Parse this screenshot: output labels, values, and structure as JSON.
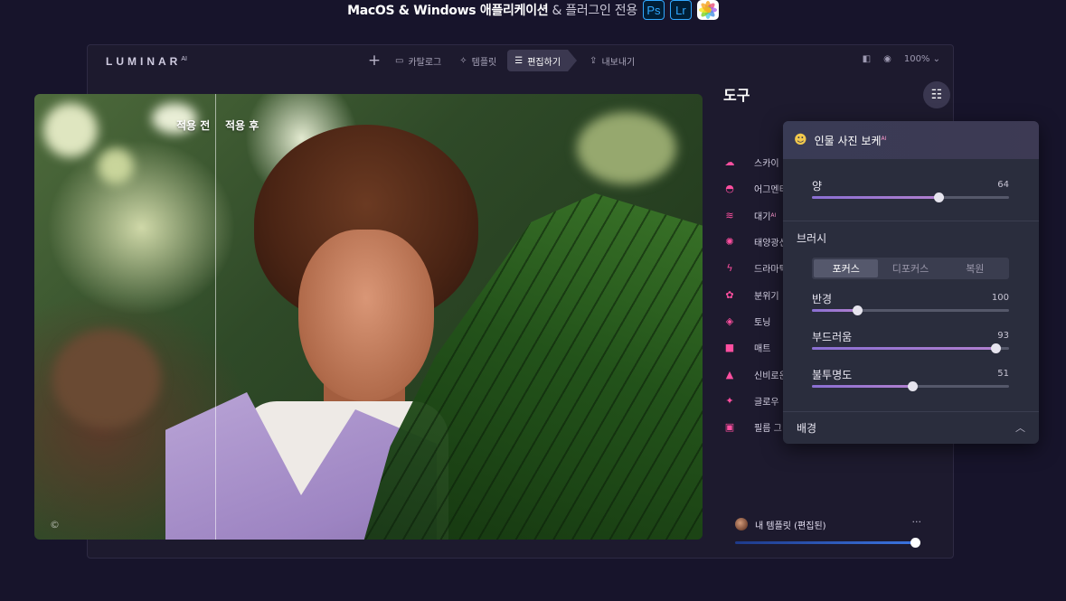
{
  "banner": {
    "text_main": "MacOS & Windows 애플리케이션",
    "text_sub": " & 플러그인 전용",
    "badges": [
      "Ps",
      "Lr"
    ]
  },
  "window": {
    "logo": "LUMINAR",
    "logo_sup": "AI",
    "nav": {
      "plus": "+",
      "catalog": "카탈로그",
      "templates": "템플릿",
      "edit": "편집하기",
      "export": "내보내기"
    },
    "zoom": "100%"
  },
  "photo": {
    "before_label": "적용 전",
    "after_label": "적용 후",
    "copyright": "©"
  },
  "tools": {
    "title": "도구",
    "items": [
      {
        "icon": "cloud-icon",
        "label": "스카이"
      },
      {
        "icon": "augmented-sky-icon",
        "label": "어그멘티"
      },
      {
        "icon": "atmosphere-icon",
        "label": "대기"
      },
      {
        "icon": "sunrays-icon",
        "label": "태양광선"
      },
      {
        "icon": "dramatic-icon",
        "label": "드라마틱"
      },
      {
        "icon": "mood-icon",
        "label": "분위기"
      },
      {
        "icon": "toning-icon",
        "label": "토닝"
      },
      {
        "icon": "matte-icon",
        "label": "매트"
      },
      {
        "icon": "mystical-icon",
        "label": "신비로운"
      },
      {
        "icon": "glow-icon",
        "label": "글로우"
      },
      {
        "icon": "film-grain-icon",
        "label": "필름 그"
      }
    ],
    "atmosphere_sup": "AI",
    "template": {
      "label": "내 템플릿 (편집된)",
      "more": "···"
    }
  },
  "popup": {
    "title": "인물 사진 보케",
    "title_sup": "AI",
    "amount": {
      "label": "양",
      "value": 64,
      "value_text": "64"
    },
    "brush": {
      "title": "브러시",
      "modes": [
        "포커스",
        "디포커스",
        "복원"
      ],
      "selected": "포커스"
    },
    "radius": {
      "label": "반경",
      "value": 100,
      "value_text": "100"
    },
    "softness": {
      "label": "부드러움",
      "value": 93,
      "value_text": "93"
    },
    "opacity": {
      "label": "불투명도",
      "value": 51,
      "value_text": "51"
    },
    "background": {
      "label": "배경"
    }
  },
  "colors": {
    "accent_pink": "#ff4fa0",
    "bg": "#17142b",
    "panel": "#2a2d3d"
  }
}
